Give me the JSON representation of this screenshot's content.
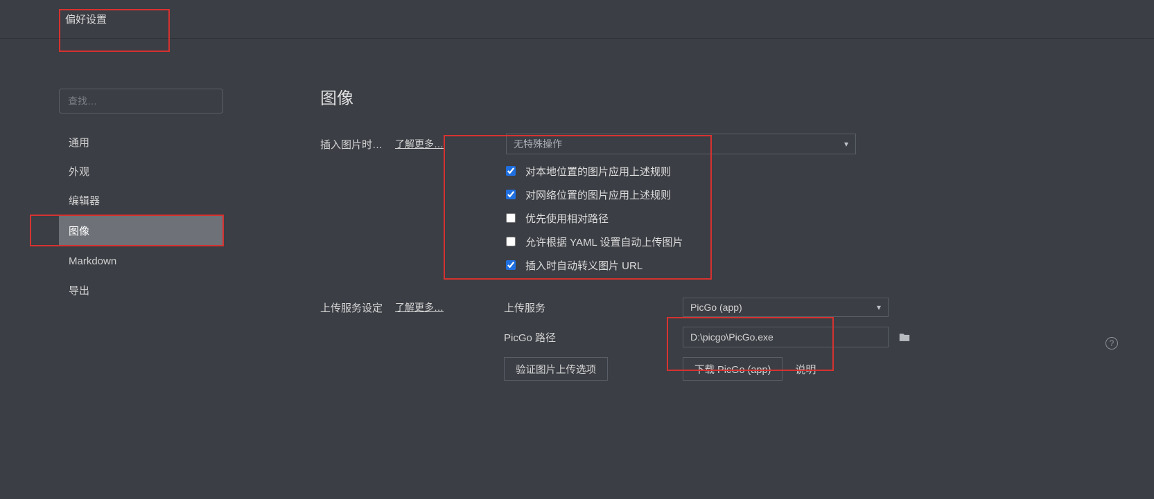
{
  "title": "偏好设置",
  "search_placeholder": "查找…",
  "sidebar": {
    "items": [
      {
        "label": "通用"
      },
      {
        "label": "外观"
      },
      {
        "label": "编辑器"
      },
      {
        "label": "图像"
      },
      {
        "label": "Markdown"
      },
      {
        "label": "导出"
      }
    ]
  },
  "main": {
    "heading": "图像",
    "insert_label": "插入图片时…",
    "learn_more": "了解更多…",
    "insert_action_selected": "无特殊操作",
    "checkboxes": {
      "apply_local": {
        "label": "对本地位置的图片应用上述规则",
        "checked": true
      },
      "apply_network": {
        "label": "对网络位置的图片应用上述规则",
        "checked": true
      },
      "prefer_relative": {
        "label": "优先使用相对路径",
        "checked": false
      },
      "yaml_auto_upload": {
        "label": "允许根据 YAML 设置自动上传图片",
        "checked": false
      },
      "escape_url": {
        "label": "插入时自动转义图片 URL",
        "checked": true
      }
    }
  },
  "upload": {
    "heading": "上传服务设定",
    "learn_more": "了解更多…",
    "service_label": "上传服务",
    "service_selected": "PicGo (app)",
    "path_label": "PicGo 路径",
    "path_value": "D:\\picgo\\PicGo.exe",
    "verify_btn": "验证图片上传选项",
    "download_btn": "下载 PicGo (app)",
    "manual_link": "说明"
  },
  "help_glyph": "?"
}
